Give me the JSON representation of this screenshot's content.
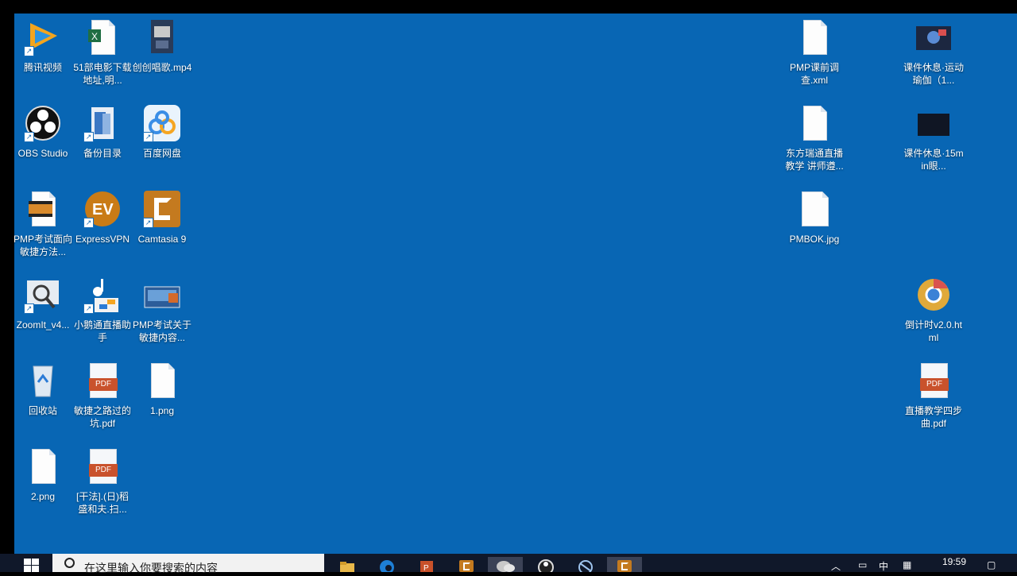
{
  "desktop": {
    "background": "#0866b4",
    "icons": [
      {
        "label": "腾讯视频",
        "icon": "tencent-video-icon"
      },
      {
        "label": "51部电影下载地址,明...",
        "icon": "excel-file-icon"
      },
      {
        "label": "创创唱歌.mp4",
        "icon": "video-file-icon"
      },
      {
        "label": "OBS Studio",
        "icon": "obs-icon"
      },
      {
        "label": "备份目录",
        "icon": "folder-icon"
      },
      {
        "label": "百度网盘",
        "icon": "baidu-netdisk-icon"
      },
      {
        "label": "PMP考试面向敏捷方法...",
        "icon": "camtasia-file-icon"
      },
      {
        "label": "ExpressVPN",
        "icon": "expressvpn-icon"
      },
      {
        "label": "Camtasia 9",
        "icon": "camtasia-icon"
      },
      {
        "label": "ZoomIt_v4...",
        "icon": "zoomit-icon"
      },
      {
        "label": "小鹅通直播助手",
        "icon": "xiaoe-live-icon"
      },
      {
        "label": "PMP考试关于敏捷内容...",
        "icon": "ppt-file-icon"
      },
      {
        "label": "回收站",
        "icon": "recycle-bin-icon"
      },
      {
        "label": "敏捷之路过的坑.pdf",
        "icon": "pdf-file-icon"
      },
      {
        "label": "1.png",
        "icon": "image-file-icon"
      },
      {
        "label": "2.png",
        "icon": "image-file-icon"
      },
      {
        "label": "[干法].(日)稻盛和夫.扫...",
        "icon": "pdf-file-icon"
      },
      {
        "label": "PMP课前调查.xml",
        "icon": "xml-file-icon"
      },
      {
        "label": "课件休息·运动瑜伽（1...",
        "icon": "video-file-icon"
      },
      {
        "label": "东方瑞通直播教学 讲师遵...",
        "icon": "document-file-icon"
      },
      {
        "label": "课件休息·15min眼...",
        "icon": "video-file-icon"
      },
      {
        "label": "PMBOK.jpg",
        "icon": "image-file-icon"
      },
      {
        "label": "倒计时v2.0.html",
        "icon": "chrome-html-icon"
      },
      {
        "label": "直播教学四步曲.pdf",
        "icon": "pdf-file-icon"
      }
    ]
  },
  "taskbar": {
    "search_placeholder": "在这里输入你要搜索的内容",
    "pinned": [
      "file-explorer-icon",
      "edge-icon",
      "powerpoint-icon",
      "camtasia-icon",
      "wechat-icon",
      "obs-icon",
      "screen-capture-icon",
      "camtasia-recorder-icon"
    ],
    "ime": "中",
    "time": "19:59"
  }
}
